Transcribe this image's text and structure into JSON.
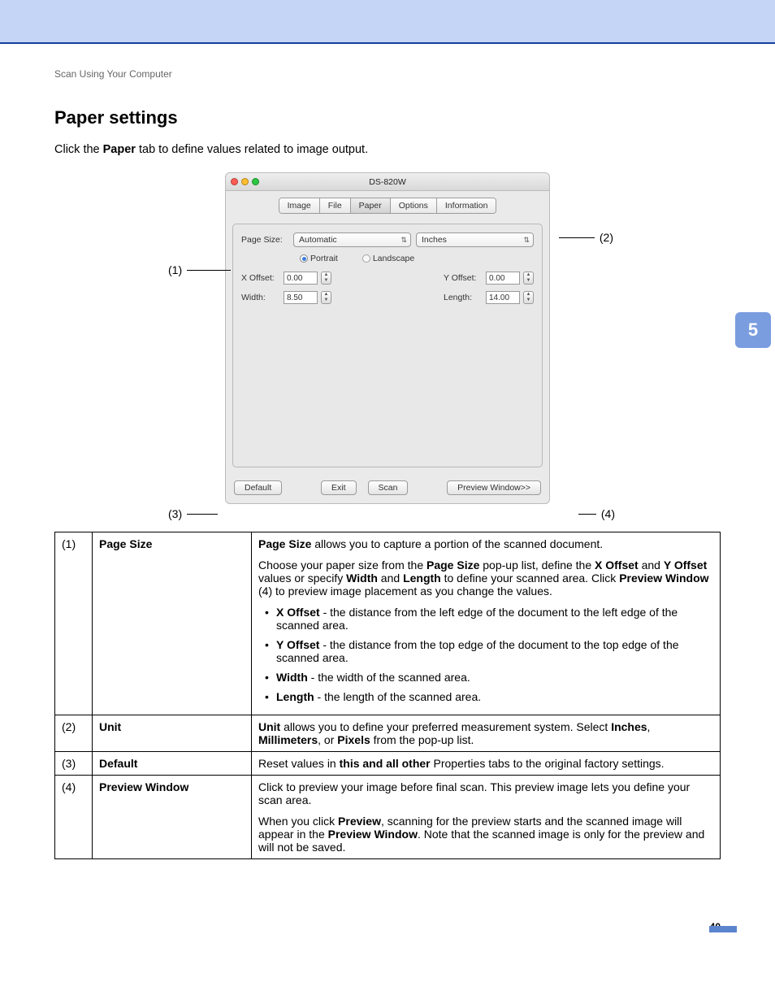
{
  "breadcrumb": "Scan Using Your Computer",
  "heading": "Paper settings",
  "intro_pre": "Click the ",
  "intro_bold": "Paper",
  "intro_post": " tab to define values related to image output.",
  "chapter": "5",
  "page_number": "40",
  "callouts": {
    "c1": "(1)",
    "c2": "(2)",
    "c3": "(3)",
    "c4": "(4)"
  },
  "shot": {
    "title": "DS-820W",
    "tabs": {
      "image": "Image",
      "file": "File",
      "paper": "Paper",
      "options": "Options",
      "information": "Information"
    },
    "page_size_label": "Page Size:",
    "page_size_value": "Automatic",
    "unit_value": "Inches",
    "portrait": "Portrait",
    "landscape": "Landscape",
    "xoffset_label": "X Offset:",
    "xoffset_value": "0.00",
    "yoffset_label": "Y Offset:",
    "yoffset_value": "0.00",
    "width_label": "Width:",
    "width_value": "8.50",
    "length_label": "Length:",
    "length_value": "14.00",
    "default_btn": "Default",
    "exit_btn": "Exit",
    "scan_btn": "Scan",
    "preview_btn": "Preview Window>>"
  },
  "table": {
    "r1": {
      "num": "(1)",
      "key": "Page Size",
      "p1_a": "Page Size",
      "p1_b": " allows you to capture a portion of the scanned document.",
      "p2_a": "Choose your paper size from the ",
      "p2_b": "Page Size",
      "p2_c": " pop-up list, define the ",
      "p2_d": "X Offset",
      "p2_e": " and ",
      "p2_f": "Y Offset",
      "p2_g": " values or specify ",
      "p2_h": "Width",
      "p2_i": " and ",
      "p2_j": "Length",
      "p2_k": " to define your scanned area. Click ",
      "p2_l": "Preview Window",
      "p2_m": " (4) to preview image placement as you change the values.",
      "li1_a": "X Offset",
      "li1_b": " - the distance from the left edge of the document to the left edge of the scanned area.",
      "li2_a": "Y Offset",
      "li2_b": " - the distance from the top edge of the document to the top edge of the scanned area.",
      "li3_a": "Width",
      "li3_b": " - the width of the scanned area.",
      "li4_a": "Length",
      "li4_b": " - the length of the scanned area."
    },
    "r2": {
      "num": "(2)",
      "key": "Unit",
      "a": "Unit",
      "b": " allows you to define your preferred measurement system. Select ",
      "c": "Inches",
      "d": ", ",
      "e": "Millimeters",
      "f": ", or ",
      "g": "Pixels",
      "h": " from the pop-up list."
    },
    "r3": {
      "num": "(3)",
      "key": "Default",
      "a": "Reset values in ",
      "b": "this and all other",
      "c": " Properties tabs to the original factory settings."
    },
    "r4": {
      "num": "(4)",
      "key": "Preview Window",
      "p1": "Click to preview your image before final scan. This preview image lets you define your scan area.",
      "p2_a": "When you click ",
      "p2_b": "Preview",
      "p2_c": ", scanning for the preview starts and the scanned image will appear in the ",
      "p2_d": "Preview Window",
      "p2_e": ". Note that the scanned image is only for the preview and will not be saved."
    }
  }
}
